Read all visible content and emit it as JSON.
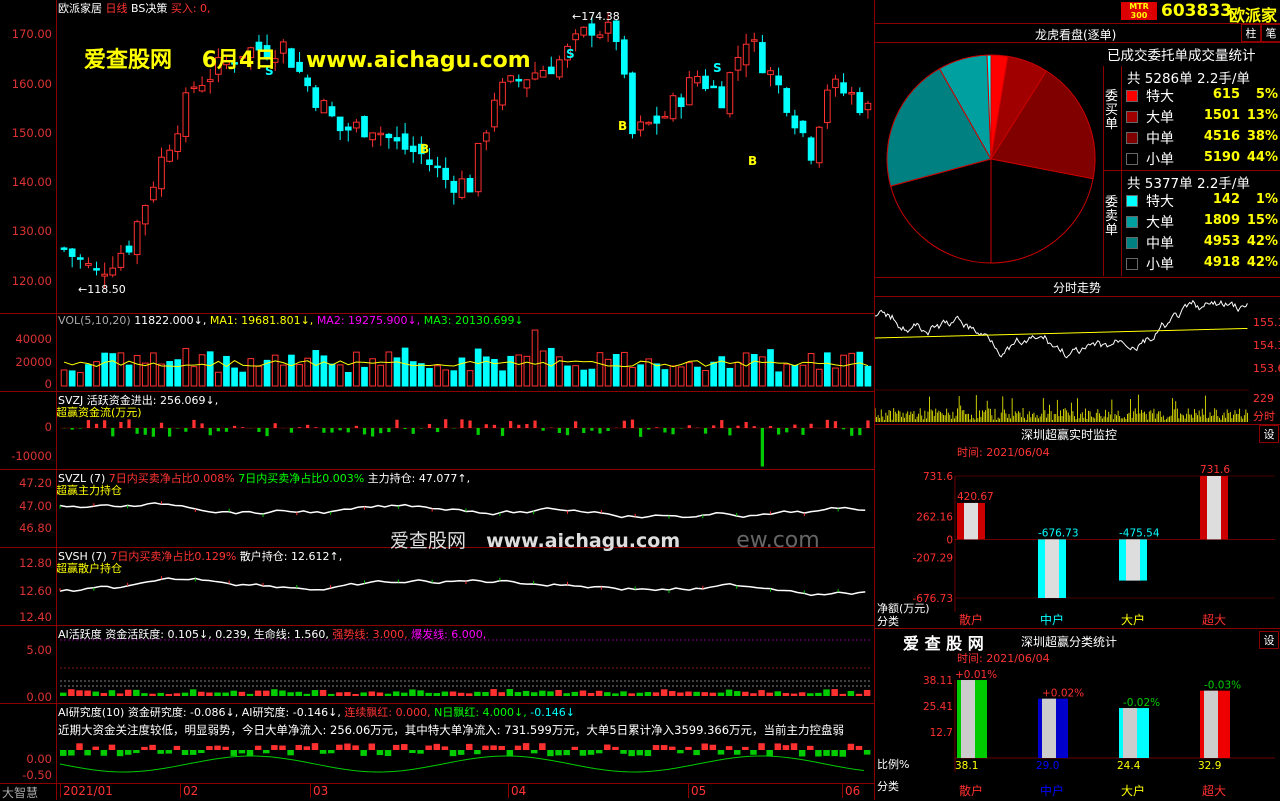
{
  "main_chart": {
    "title": "欧派家居",
    "title_period": "日线",
    "indicator": "BS决策",
    "buy_label": "买入: 0,",
    "watermark_site": "爱查股网",
    "watermark_date": "6月4日",
    "watermark_url": "www.aichagu.com",
    "y_ticks": [
      "170.00",
      "160.00",
      "150.00",
      "140.00",
      "130.00",
      "120.00"
    ],
    "high_marker": "174.38",
    "low_marker": "118.50"
  },
  "vol_panel": {
    "header": "VOL(5,10,20)",
    "v": "11822.000↓,",
    "ma1": "MA1: 19681.801↓,",
    "ma2": "MA2: 19275.900↓,",
    "ma3": "MA3: 20130.699↓",
    "y_ticks": [
      "40000",
      "20000",
      "0"
    ]
  },
  "svzj_panel": {
    "header": "SVZJ   活跃资金进出: 256.069↓,",
    "subtitle": "超赢资金流(万元)",
    "y_ticks": [
      "0",
      "-10000"
    ]
  },
  "svzl_panel": {
    "header_a": "SVZL (7)",
    "header_b": "7日内买卖净占比0.008%",
    "header_c": "7日内买卖净占比0.003%",
    "header_d": "主力持仓: 47.077↑,",
    "subtitle": "超赢主力持仓",
    "y_ticks": [
      "47.20",
      "47.00",
      "46.80"
    ]
  },
  "svsh_panel": {
    "header_a": "SVSH (7)",
    "header_b": "7日内买卖净占比0.129%",
    "header_c": "散户持仓: 12.612↑,",
    "subtitle": "超赢散户持仓",
    "y_ticks": [
      "12.80",
      "12.60",
      "12.40"
    ],
    "watermark_site": "爱查股网",
    "watermark_url": "www.aichagu.com",
    "watermark_faded": "ew.com"
  },
  "ai_active_panel": {
    "header_a": "AI活跃度",
    "header_b": "资金活跃度: 0.105↓,",
    "header_c": "0.239,",
    "header_d": "生命线: 1.560,",
    "header_e": "强势线: 3.000,",
    "header_f": "爆发线: 6.000,",
    "y_ticks": [
      "5.00",
      "0.00"
    ]
  },
  "ai_research_panel": {
    "header_a": "AI研究度(10)",
    "header_b": "资金研究度: -0.086↓,",
    "header_c": "AI研究度: -0.146↓,",
    "header_d": "连续飘红: 0.000,",
    "header_e": "N日飘红: 4.000↓,",
    "header_f": "-0.146↓",
    "comment": "近期大资金关注度较低，明显弱势，今日大单净流入: 256.06万元，其中特大单净流入: 731.599万元，大单5日累计净入3599.366万元，当前主力控盘弱",
    "y_ticks": [
      "0.00",
      "-0.50"
    ]
  },
  "date_axis": {
    "brand": "大智慧",
    "labels": [
      "2021/01",
      "02",
      "03",
      "04",
      "05",
      "06"
    ]
  },
  "right_panel": {
    "logo_badge": "MTR 300",
    "code": "603833",
    "name": "欧派家",
    "tab_bar": "柱",
    "tab_line": "笔",
    "pie_title": "龙虎看盘(逐单)",
    "pie_subtitle": "已成交委托单成交量统计",
    "buy_group_label": "委买单",
    "sell_group_label": "委卖单",
    "buy_total": "共 5286单 2.2手/单",
    "sell_total": "共 5377单 2.2手/单",
    "buy_rows": [
      {
        "name": "特大",
        "count": "615",
        "pct": "5%",
        "color": "#ff0000"
      },
      {
        "name": "大单",
        "count": "1501",
        "pct": "13%",
        "color": "#a00000"
      },
      {
        "name": "中单",
        "count": "4516",
        "pct": "38%",
        "color": "#800000"
      },
      {
        "name": "小单",
        "count": "5190",
        "pct": "44%",
        "color": "#000000"
      }
    ],
    "sell_rows": [
      {
        "name": "特大",
        "count": "142",
        "pct": "1%",
        "color": "#00ffff"
      },
      {
        "name": "大单",
        "count": "1809",
        "pct": "15%",
        "color": "#00a0a0"
      },
      {
        "name": "中单",
        "count": "4953",
        "pct": "42%",
        "color": "#008080"
      },
      {
        "name": "小单",
        "count": "4918",
        "pct": "42%",
        "color": "#000000"
      }
    ],
    "intraday_title": "分时走势",
    "intraday_ticks": [
      "155.1",
      "154.3",
      "153.6"
    ],
    "intraday_vol_tick": "229",
    "intraday_vol_label": "分时",
    "monitor_title": "深圳超赢实时监控",
    "monitor_time": "时间: 2021/06/04",
    "monitor_setting": "设",
    "monitor_y": [
      "731.6",
      "262.16",
      "0",
      "-207.29",
      "-676.73"
    ],
    "monitor_axis_unit": "净额(万元)",
    "monitor_axis_cat": "分类",
    "monitor_bars": [
      {
        "cat": "散户",
        "value": 420.67,
        "label": "420.67"
      },
      {
        "cat": "中户",
        "value": -676.73,
        "label": "-676.73"
      },
      {
        "cat": "大户",
        "value": -475.54,
        "label": "-475.54"
      },
      {
        "cat": "超大",
        "value": 731.6,
        "label": "731.6"
      }
    ],
    "stat_logo": "爱 查 股 网",
    "stat_title": "深圳超赢分类统计",
    "stat_time": "时间: 2021/06/04",
    "stat_setting": "设",
    "stat_y": [
      "38.11",
      "25.41",
      "12.7"
    ],
    "stat_axis_ratio": "比例%",
    "stat_axis_cat": "分类",
    "stat_bars": [
      {
        "cat": "散户",
        "value": 38.1,
        "label": "38.1",
        "delta": "+0.01%"
      },
      {
        "cat": "中户",
        "value": 29.0,
        "label": "29.0",
        "delta": "+0.02%"
      },
      {
        "cat": "大户",
        "value": 24.4,
        "label": "24.4",
        "delta": "-0.02%"
      },
      {
        "cat": "超大",
        "value": 32.9,
        "label": "32.9",
        "delta": "-0.03%"
      }
    ]
  },
  "colors": {
    "up": "#ff3030",
    "down": "#00ffff",
    "grid": "#8b0000",
    "accent_yellow": "#ffff00"
  }
}
